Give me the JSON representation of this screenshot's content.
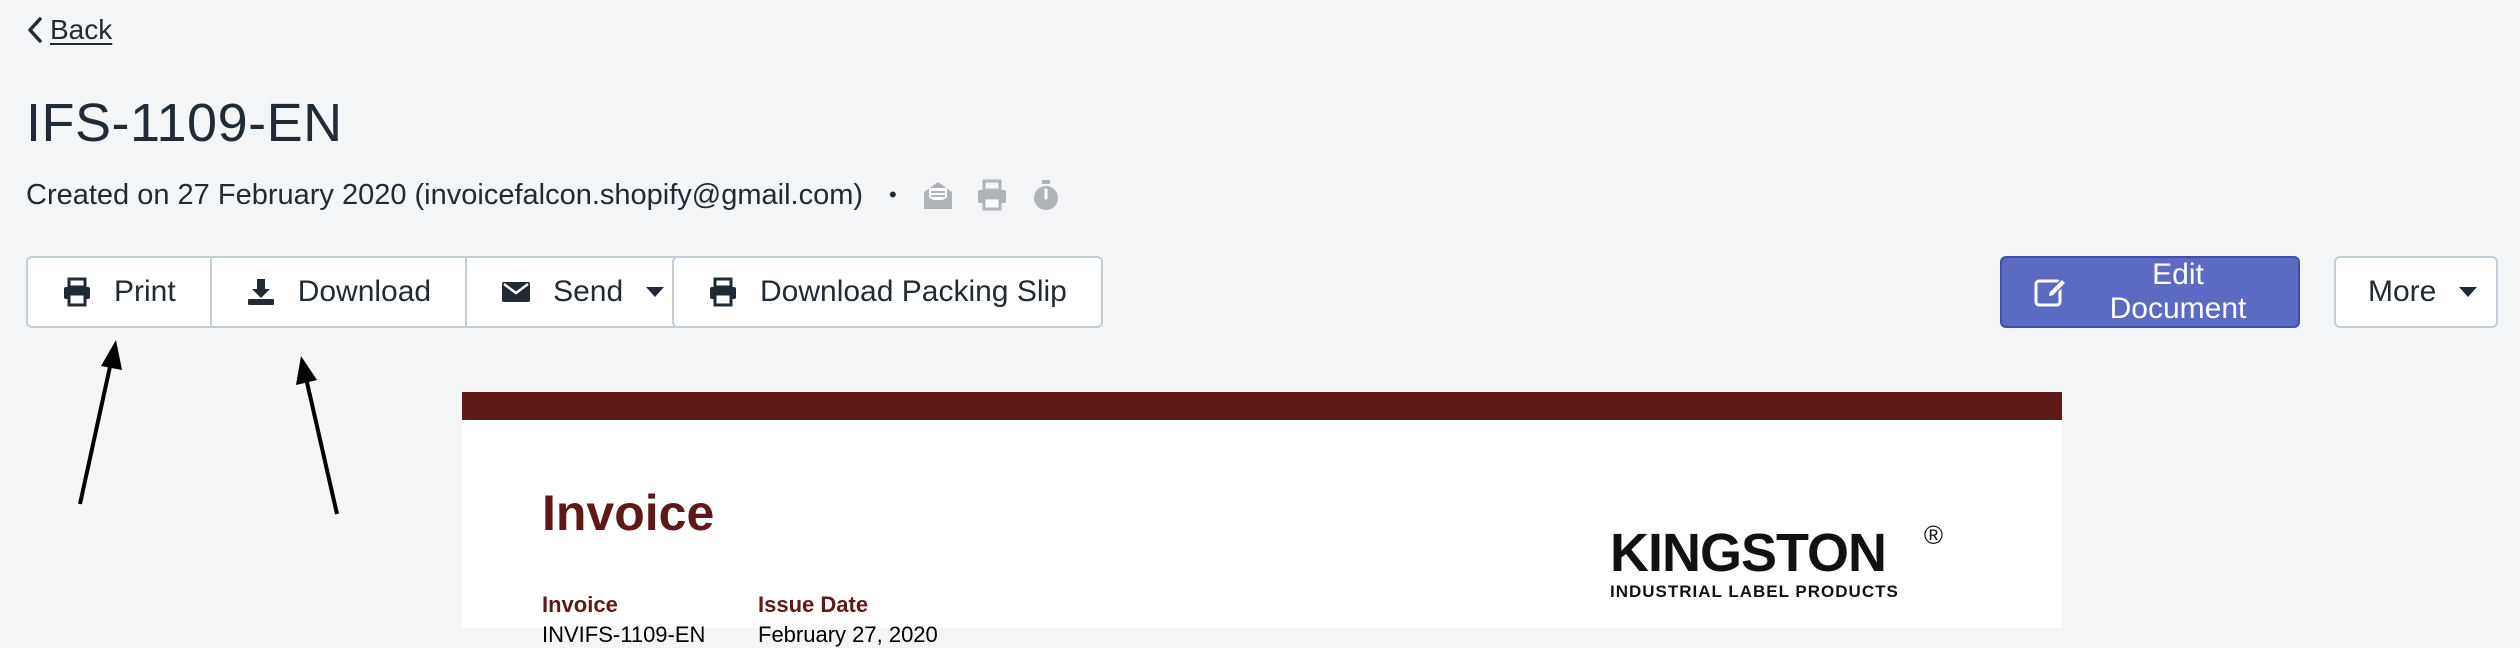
{
  "nav": {
    "back_label": "Back"
  },
  "document": {
    "title": "IFS-1109-EN",
    "created_text": "Created on 27 February 2020 (invoicefalcon.shopify@gmail.com)",
    "separator": "•",
    "status_icons": [
      "email-sent-icon",
      "printed-icon",
      "timer-icon"
    ]
  },
  "toolbar": {
    "print_label": "Print",
    "download_label": "Download",
    "send_label": "Send",
    "packing_slip_label": "Download Packing Slip",
    "edit_label": "Edit Document",
    "more_label": "More"
  },
  "preview": {
    "heading": "Invoice",
    "invoice_label": "Invoice",
    "invoice_value": "INVIFS-1109-EN",
    "issue_date_label": "Issue Date",
    "issue_date_value": "February 27, 2020",
    "logo_main": "KINGSTON",
    "logo_reg": "®",
    "logo_sub": "INDUSTRIAL LABEL PRODUCTS"
  },
  "colors": {
    "accent": "#5c6ac4",
    "invoice_brand": "#5e1a19",
    "background": "#f4f5f7"
  }
}
